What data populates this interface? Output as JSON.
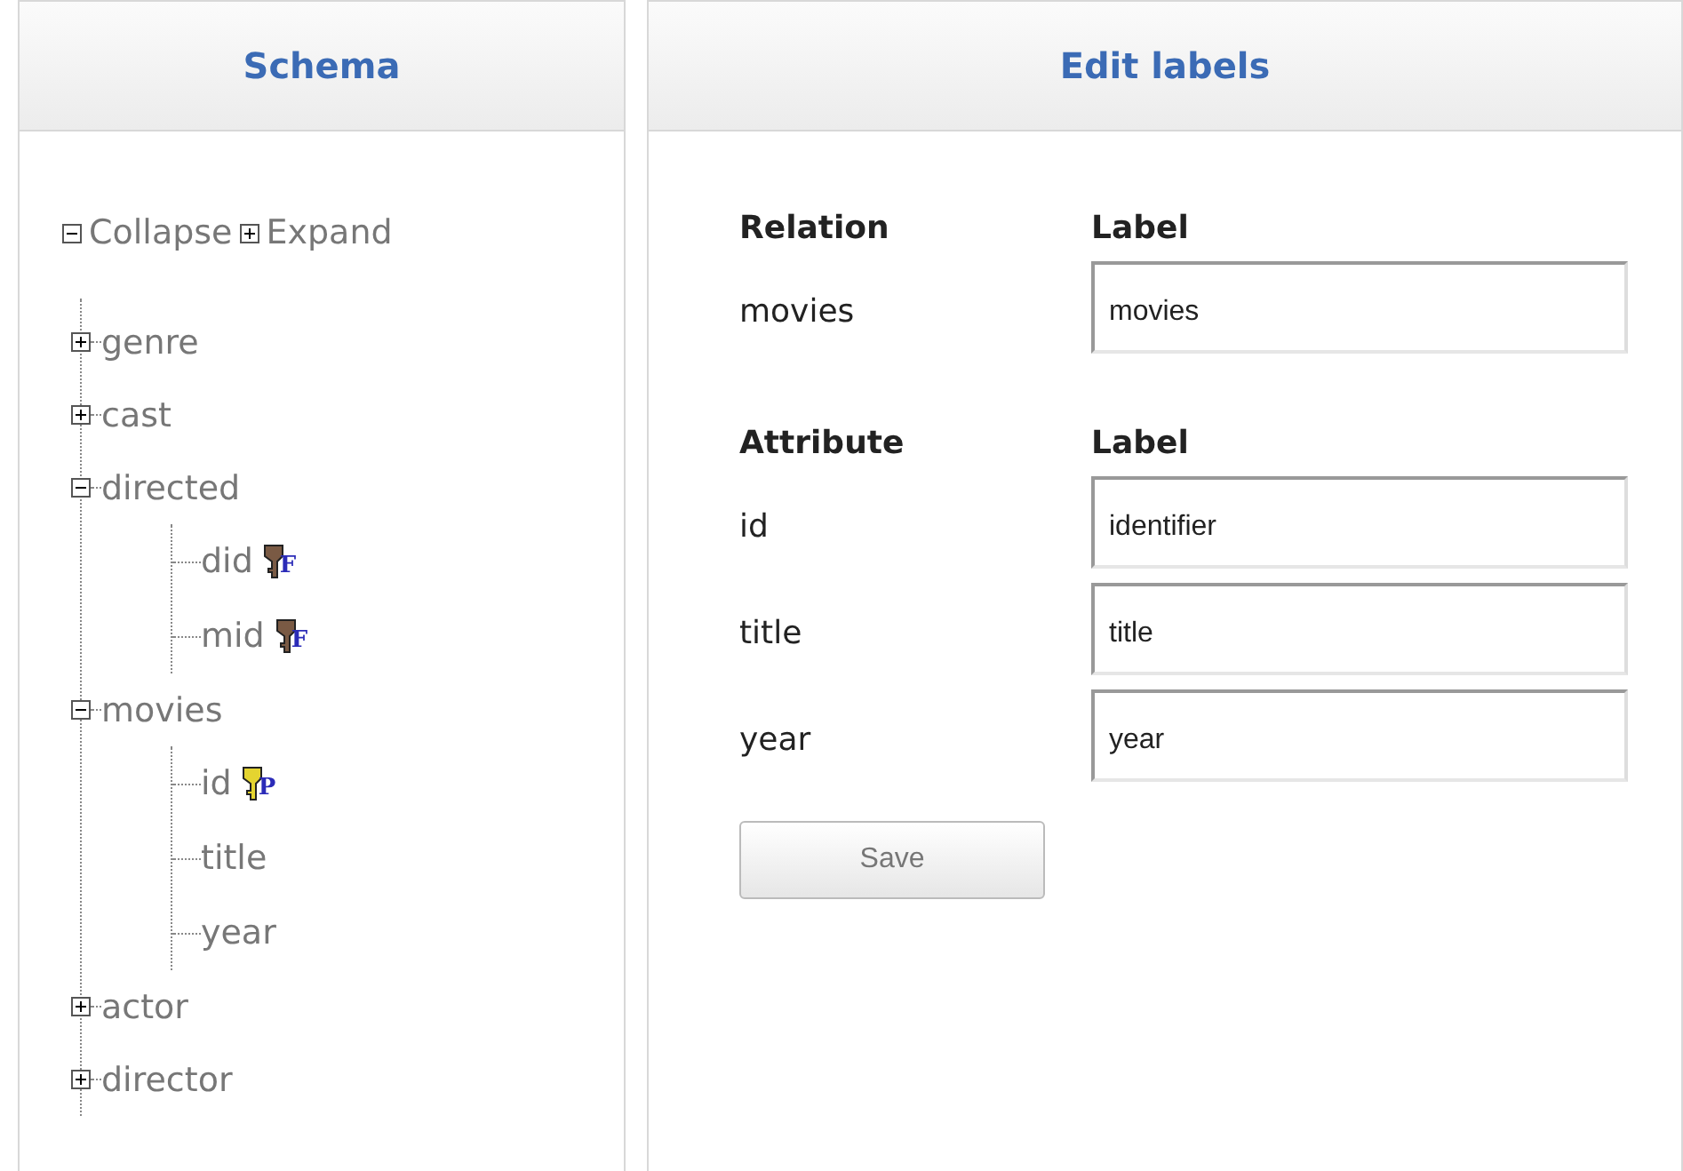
{
  "schema_panel": {
    "title": "Schema",
    "collapse": "Collapse",
    "expand": "Expand",
    "tree": [
      {
        "name": "genre",
        "expanded": false
      },
      {
        "name": "cast",
        "expanded": false
      },
      {
        "name": "directed",
        "expanded": true,
        "children": [
          {
            "name": "did",
            "key": "F"
          },
          {
            "name": "mid",
            "key": "F"
          }
        ]
      },
      {
        "name": "movies",
        "expanded": true,
        "children": [
          {
            "name": "id",
            "key": "P"
          },
          {
            "name": "title"
          },
          {
            "name": "year"
          }
        ]
      },
      {
        "name": "actor",
        "expanded": false
      },
      {
        "name": "director",
        "expanded": false
      }
    ]
  },
  "edit_panel": {
    "title": "Edit labels",
    "relation": {
      "heading": "Relation",
      "label_heading": "Label",
      "name": "movies",
      "value": "movies"
    },
    "attributes_heading": "Attribute",
    "attributes_label_heading": "Label",
    "attributes": [
      {
        "name": "id",
        "value": "identifier"
      },
      {
        "name": "title",
        "value": "title"
      },
      {
        "name": "year",
        "value": "year"
      }
    ],
    "save": "Save"
  }
}
